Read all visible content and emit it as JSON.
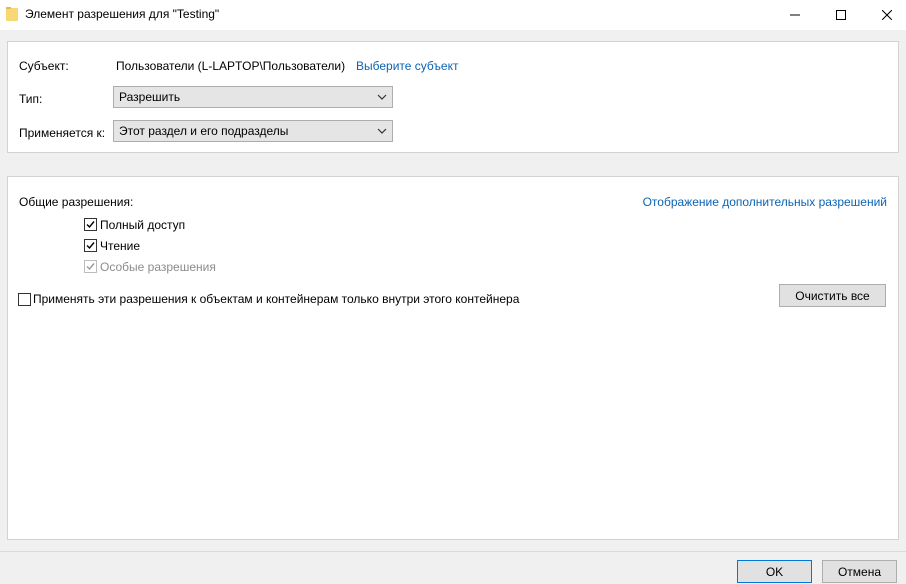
{
  "window": {
    "title": "Элемент разрешения для \"Testing\""
  },
  "principal": {
    "label": "Субъект:",
    "value": "Пользователи (L-LAPTOP\\Пользователи)",
    "select_link": "Выберите субъект"
  },
  "type": {
    "label": "Тип:",
    "selected": "Разрешить"
  },
  "applies_to": {
    "label": "Применяется к:",
    "selected": "Этот раздел и его подразделы"
  },
  "permissions": {
    "heading": "Общие разрешения:",
    "advanced_link": "Отображение дополнительных разрешений",
    "items": [
      {
        "label": "Полный доступ",
        "checked": true,
        "disabled": false
      },
      {
        "label": "Чтение",
        "checked": true,
        "disabled": false
      },
      {
        "label": "Особые разрешения",
        "checked": true,
        "disabled": true
      }
    ],
    "apply_inside_label": "Применять эти разрешения к объектам и контейнерам только внутри этого контейнера",
    "apply_inside_checked": false,
    "clear_all_label": "Очистить все"
  },
  "footer": {
    "ok_label": "OK",
    "cancel_label": "Отмена"
  },
  "colors": {
    "link": "#0a64b4",
    "primary_border": "#0078d7"
  }
}
